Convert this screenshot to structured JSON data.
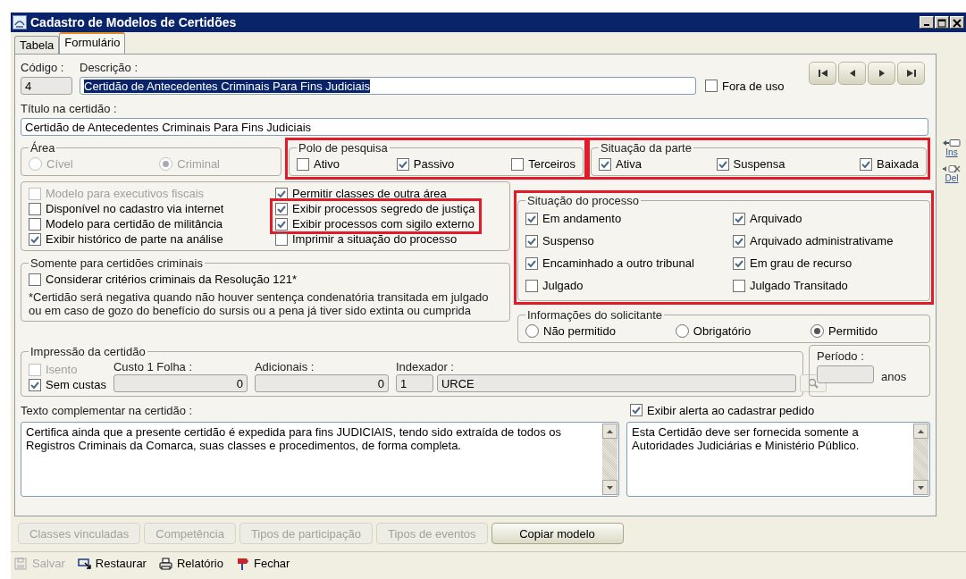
{
  "window": {
    "title": "Cadastro de Modelos de Certidões"
  },
  "tabs": [
    {
      "label": "Tabela",
      "selected": false
    },
    {
      "label": "Formulário",
      "selected": true
    }
  ],
  "codigo": {
    "label": "Código :",
    "value": "4"
  },
  "descricao": {
    "label": "Descrição :",
    "value": "Certidão de Antecedentes Criminais Para Fins Judiciais",
    "text_selected": true
  },
  "fora_de_uso": {
    "label": "Fora de uso",
    "checked": false
  },
  "nav_buttons": [
    {
      "kind": "first"
    },
    {
      "kind": "prev"
    },
    {
      "kind": "next"
    },
    {
      "kind": "last"
    }
  ],
  "titulo": {
    "label": "Título na certidão :",
    "value": "Certidão de Antecedentes Criminais Para Fins Judiciais"
  },
  "side_actions": [
    {
      "kind": "insert",
      "label": "Ins"
    },
    {
      "kind": "delete",
      "label": "Del"
    }
  ],
  "area": {
    "title": "Área",
    "disabled": true,
    "options": [
      {
        "label": "Cível",
        "selected": false
      },
      {
        "label": "Criminal",
        "selected": true
      }
    ]
  },
  "polo_de_pesquisa": {
    "title": "Polo de pesquisa",
    "highlighted": true,
    "options": [
      {
        "label": "Ativo",
        "checked": false
      },
      {
        "label": "Passivo",
        "checked": true
      },
      {
        "label": "Terceiros",
        "checked": false
      }
    ]
  },
  "situacao_da_parte": {
    "title": "Situação da parte",
    "highlighted": true,
    "options": [
      {
        "label": "Ativa",
        "checked": true
      },
      {
        "label": "Suspensa",
        "checked": true
      },
      {
        "label": "Baixada",
        "checked": true
      }
    ]
  },
  "opcoes": {
    "columns": [
      [
        {
          "label": "Modelo para executivos fiscais",
          "checked": false,
          "disabled": true,
          "highlighted": false
        },
        {
          "label": "Disponível no cadastro via internet",
          "checked": false,
          "disabled": false,
          "highlighted": false
        },
        {
          "label": "Modelo para certidão de militância",
          "checked": false,
          "disabled": false,
          "highlighted": false
        },
        {
          "label": "Exibir histórico de parte na análise",
          "checked": true,
          "disabled": false,
          "highlighted": false
        }
      ],
      [
        {
          "label": "Permitir classes de outra área",
          "checked": true,
          "disabled": false,
          "highlighted": false
        },
        {
          "label": "Exibir processos segredo de justiça",
          "checked": true,
          "disabled": false,
          "highlighted": true
        },
        {
          "label": "Exibir processos com sigilo externo",
          "checked": true,
          "disabled": false,
          "highlighted": true
        },
        {
          "label": "Imprimir a situação do processo",
          "checked": false,
          "disabled": false,
          "highlighted": false
        }
      ]
    ]
  },
  "situacao_do_processo": {
    "title": "Situação do processo",
    "highlighted": true,
    "options": [
      {
        "label": "Em andamento",
        "checked": true
      },
      {
        "label": "Arquivado",
        "checked": true
      },
      {
        "label": "Suspenso",
        "checked": true
      },
      {
        "label": "Arquivado administrativame",
        "checked": true
      },
      {
        "label": "Encaminhado a outro tribunal",
        "checked": true
      },
      {
        "label": "Em grau de recurso",
        "checked": true
      },
      {
        "label": "Julgado",
        "checked": false
      },
      {
        "label": "Julgado Transitado",
        "checked": false
      }
    ]
  },
  "somente_criminais": {
    "title": "Somente para certidões criminais",
    "option": {
      "label": "Considerar critérios criminais da Resolução 121*",
      "checked": false
    },
    "note": "*Certidão será negativa quando não houver sentença condenatória transitada em julgado ou em caso de gozo do benefício do sursis ou a pena já tiver sido extinta ou cumprida"
  },
  "informacoes_do_solicitante": {
    "title": "Informações do solicitante",
    "options": [
      {
        "label": "Não permitido",
        "selected": false
      },
      {
        "label": "Obrigatório",
        "selected": false
      },
      {
        "label": "Permitido",
        "selected": true
      }
    ]
  },
  "impressao": {
    "title": "Impressão da certidão",
    "isento": {
      "label": "Isento",
      "checked": false,
      "disabled": true
    },
    "sem_custas": {
      "label": "Sem custas",
      "checked": true,
      "disabled": false
    },
    "custo_1_folha": {
      "label": "Custo 1 Folha :",
      "value": "0"
    },
    "adicionais": {
      "label": "Adicionais :",
      "value": "0"
    },
    "indexador": {
      "label": "Indexador :",
      "code": "1",
      "name": "URCE"
    }
  },
  "periodo": {
    "label": "Período :",
    "unit": "anos"
  },
  "texto_complementar": {
    "label": "Texto complementar na certidão :",
    "value": "Certifica ainda que a presente certidão é expedida para fins JUDICIAIS, tendo sido extraída de todos os Registros Criminais da Comarca, suas classes e procedimentos, de forma completa."
  },
  "alerta": {
    "label": "Exibir alerta ao cadastrar pedido",
    "checked": true,
    "value": "Esta Certidão deve ser fornecida somente a Autoridades Judiciárias e Ministério Público."
  },
  "action_buttons": [
    {
      "label": "Classes vinculadas",
      "disabled": true
    },
    {
      "label": "Competência",
      "disabled": true
    },
    {
      "label": "Tipos de participação",
      "disabled": true
    },
    {
      "label": "Tipos de eventos",
      "disabled": true
    },
    {
      "label": "Copiar modelo",
      "disabled": false
    }
  ],
  "toolbar": [
    {
      "kind": "save",
      "label": "Salvar",
      "disabled": true
    },
    {
      "kind": "restore",
      "label": "Restaurar",
      "disabled": false
    },
    {
      "kind": "report",
      "label": "Relatório",
      "disabled": false
    },
    {
      "kind": "close",
      "label": "Fechar",
      "disabled": false
    }
  ]
}
